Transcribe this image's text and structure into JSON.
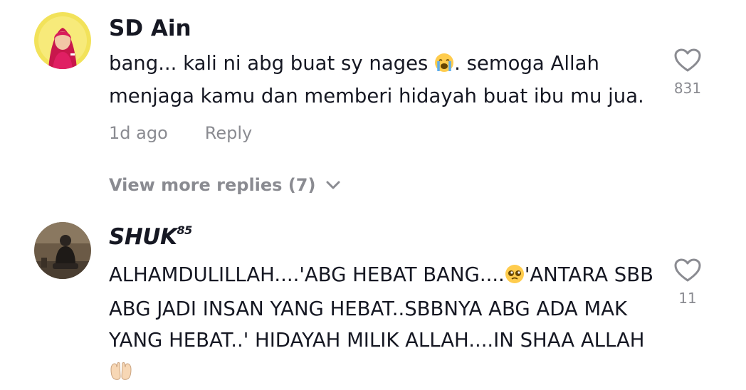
{
  "comments": [
    {
      "username": "SD Ain",
      "text_before_emoji": "bang... kali ni abg buat sy nages ",
      "emoji": "loudly-crying-face",
      "text_after_emoji": ". semoga Allah menjaga kamu dan memberi hidayah buat ibu mu jua.",
      "time": "1d ago",
      "reply_label": "Reply",
      "likes": "831"
    },
    {
      "username": "SHUK",
      "username_sup": "85",
      "text_part1": "ALHAMDULILLAH....'ABG HEBAT BANG....",
      "emoji1": "pleading-face",
      "text_part2": "'ANTARA SBB ABG JADI INSAN YANG HEBAT..SBBNYA ABG ADA MAK YANG HEBAT..' HIDAYAH MILIK ALLAH....IN SHAA ALLAH",
      "emoji2": "palms-up-together",
      "likes": "11"
    }
  ],
  "view_more_replies": "View more replies (7)",
  "colors": {
    "text": "#161823",
    "muted": "#8a8b91",
    "background": "#ffffff"
  }
}
